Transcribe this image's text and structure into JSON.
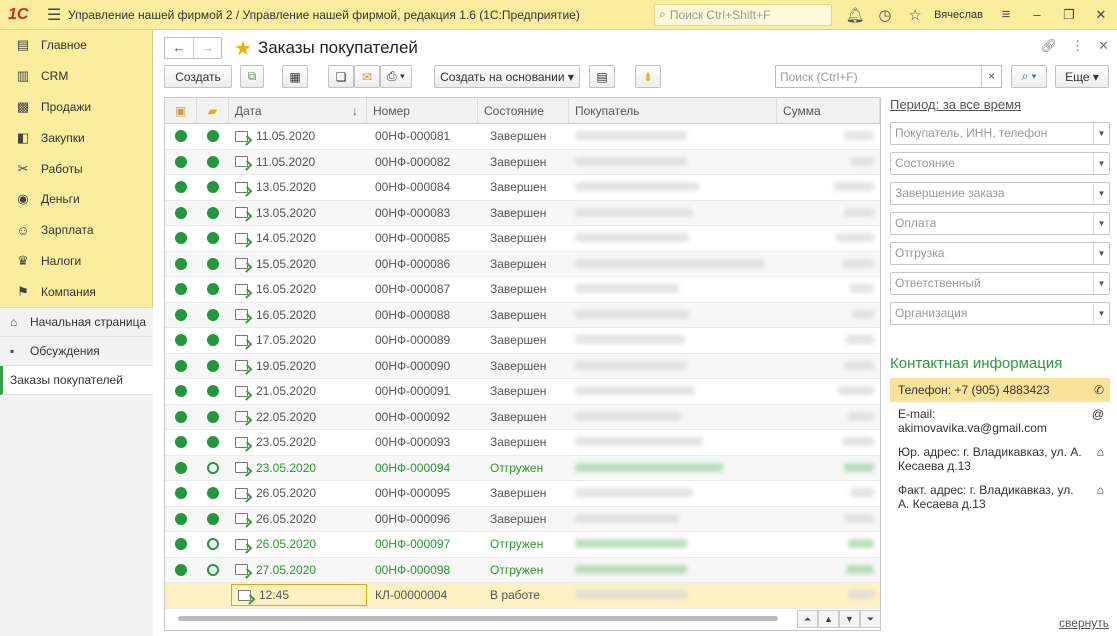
{
  "titlebar": {
    "logo": "1C",
    "app_title": "Управление нашей фирмой 2 / Управление нашей фирмой, редакция 1.6  (1С:Предприятие)",
    "search_placeholder": "Поиск Ctrl+Shift+F",
    "user": "Вячеслав"
  },
  "sidebar": {
    "items": [
      {
        "label": "Главное",
        "icon": "menu-icon"
      },
      {
        "label": "CRM",
        "icon": "crm-icon"
      },
      {
        "label": "Продажи",
        "icon": "sales-icon"
      },
      {
        "label": "Закупки",
        "icon": "purchases-icon"
      },
      {
        "label": "Работы",
        "icon": "tools-icon"
      },
      {
        "label": "Деньги",
        "icon": "money-icon"
      },
      {
        "label": "Зарплата",
        "icon": "people-icon"
      },
      {
        "label": "Налоги",
        "icon": "taxes-icon"
      },
      {
        "label": "Компания",
        "icon": "flag-icon"
      }
    ],
    "lower": [
      {
        "label": "Начальная страница",
        "icon": "home-icon"
      },
      {
        "label": "Обсуждения",
        "icon": "chat-icon"
      },
      {
        "label": "Заказы покупателей",
        "icon": ""
      }
    ]
  },
  "form": {
    "title": "Заказы покупателей",
    "toolbar": {
      "create": "Создать",
      "create_based": "Создать на основании",
      "search_placeholder": "Поиск (Ctrl+F)",
      "more": "Еще"
    }
  },
  "table": {
    "columns": [
      "Дата",
      "Номер",
      "Состояние",
      "Покупатель",
      "Сумма"
    ],
    "rows": [
      {
        "date": "11.05.2020",
        "number": "00НФ-000081",
        "status": "Завершен",
        "paid": true,
        "shipped": true
      },
      {
        "date": "11.05.2020",
        "number": "00НФ-000082",
        "status": "Завершен",
        "paid": true,
        "shipped": true
      },
      {
        "date": "13.05.2020",
        "number": "00НФ-000084",
        "status": "Завершен",
        "paid": true,
        "shipped": true
      },
      {
        "date": "13.05.2020",
        "number": "00НФ-000083",
        "status": "Завершен",
        "paid": true,
        "shipped": true
      },
      {
        "date": "14.05.2020",
        "number": "00НФ-000085",
        "status": "Завершен",
        "paid": true,
        "shipped": true
      },
      {
        "date": "15.05.2020",
        "number": "00НФ-000086",
        "status": "Завершен",
        "paid": true,
        "shipped": true
      },
      {
        "date": "16.05.2020",
        "number": "00НФ-000087",
        "status": "Завершен",
        "paid": true,
        "shipped": true
      },
      {
        "date": "16.05.2020",
        "number": "00НФ-000088",
        "status": "Завершен",
        "paid": true,
        "shipped": true
      },
      {
        "date": "17.05.2020",
        "number": "00НФ-000089",
        "status": "Завершен",
        "paid": true,
        "shipped": true
      },
      {
        "date": "19.05.2020",
        "number": "00НФ-000090",
        "status": "Завершен",
        "paid": true,
        "shipped": true
      },
      {
        "date": "21.05.2020",
        "number": "00НФ-000091",
        "status": "Завершен",
        "paid": true,
        "shipped": true
      },
      {
        "date": "22.05.2020",
        "number": "00НФ-000092",
        "status": "Завершен",
        "paid": true,
        "shipped": true
      },
      {
        "date": "23.05.2020",
        "number": "00НФ-000093",
        "status": "Завершен",
        "paid": true,
        "shipped": true
      },
      {
        "date": "23.05.2020",
        "number": "00НФ-000094",
        "status": "Отгружен",
        "paid": true,
        "shipped": false,
        "green": true
      },
      {
        "date": "26.05.2020",
        "number": "00НФ-000095",
        "status": "Завершен",
        "paid": true,
        "shipped": true
      },
      {
        "date": "26.05.2020",
        "number": "00НФ-000096",
        "status": "Завершен",
        "paid": true,
        "shipped": true
      },
      {
        "date": "26.05.2020",
        "number": "00НФ-000097",
        "status": "Отгружен",
        "paid": true,
        "shipped": false,
        "green": true
      },
      {
        "date": "27.05.2020",
        "number": "00НФ-000098",
        "status": "Отгружен",
        "paid": true,
        "shipped": false,
        "green": true
      },
      {
        "date": "12:45",
        "number": "КЛ-00000004",
        "status": "В работе",
        "current": true
      }
    ]
  },
  "filters": {
    "period": "Период: за все время",
    "fields": [
      "Покупатель, ИНН, телефон",
      "Состояние",
      "Завершение заказа",
      "Оплата",
      "Отгрузка",
      "Ответственный",
      "Организация"
    ]
  },
  "contact": {
    "title": "Контактная информация",
    "phone": "Телефон: +7 (905) 4883423",
    "email": "E-mail: akimovavika.va@gmail.com",
    "legal_address": "Юр. адрес: г. Владикавказ, ул. А. Кесаева д.13",
    "actual_address": "Факт. адрес: г. Владикавказ, ул. А. Кесаева д.13",
    "collapse": "свернуть"
  }
}
